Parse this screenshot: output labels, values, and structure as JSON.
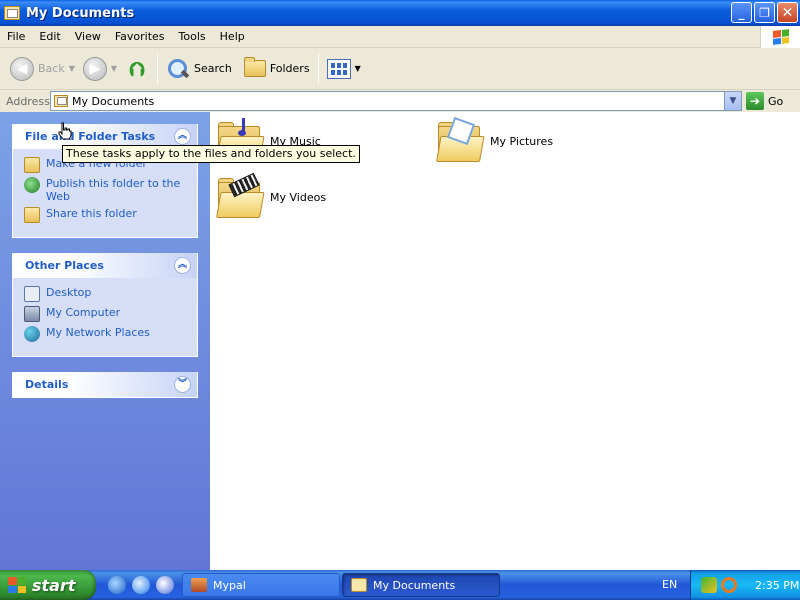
{
  "window": {
    "title": "My Documents",
    "buttons": {
      "minimize": "_",
      "maximize": "❐",
      "close": "✕"
    }
  },
  "menu": [
    "File",
    "Edit",
    "View",
    "Favorites",
    "Tools",
    "Help"
  ],
  "toolbar": {
    "back": "Back",
    "forward": "",
    "search": "Search",
    "folders": "Folders"
  },
  "address": {
    "label": "Address",
    "value": "My Documents",
    "go": "Go"
  },
  "taskpane": {
    "file_tasks": {
      "title": "File and Folder Tasks",
      "tasks": [
        "Make a new folder",
        "Publish this folder to the Web",
        "Share this folder"
      ]
    },
    "other_places": {
      "title": "Other Places",
      "items": [
        "Desktop",
        "My Computer",
        "My Network Places"
      ]
    },
    "details": {
      "title": "Details"
    }
  },
  "tooltip": "These tasks apply to the files and folders you select.",
  "items": [
    {
      "name": "My Music",
      "icon": "music-folder-icon"
    },
    {
      "name": "My Pictures",
      "icon": "pictures-folder-icon"
    },
    {
      "name": "My Videos",
      "icon": "videos-folder-icon"
    }
  ],
  "taskbar": {
    "start": "start",
    "windows": [
      "Mypal",
      "My Documents"
    ],
    "language": "EN",
    "clock": "2:35 PM"
  },
  "colors": {
    "title_bar": "#0552d5",
    "task_pane": "#6375d6",
    "link": "#215dc6",
    "taskbar": "#2157d7",
    "start": "#3c9a3c"
  }
}
